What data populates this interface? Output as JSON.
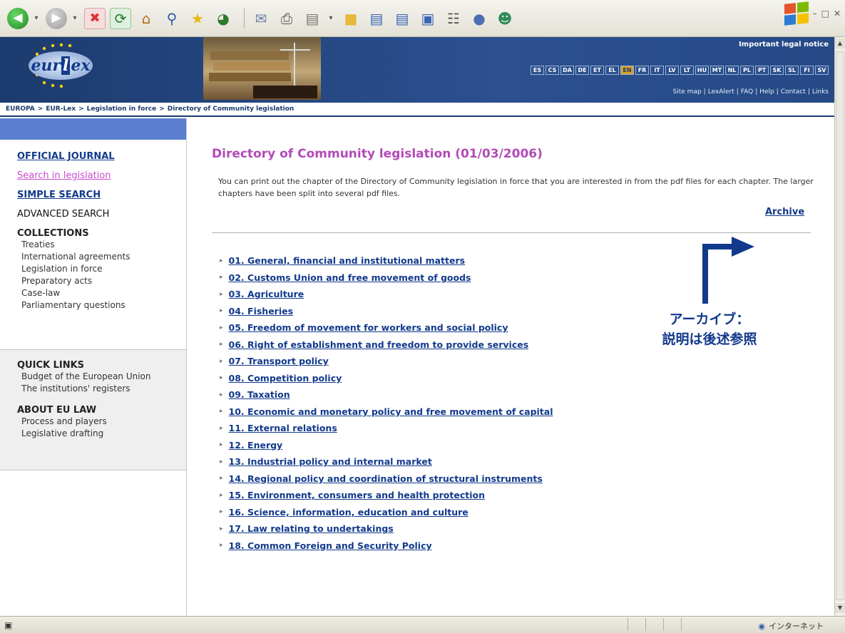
{
  "banner": {
    "legal_notice": "Important legal notice",
    "languages": [
      "ES",
      "CS",
      "DA",
      "DE",
      "ET",
      "EL",
      "EN",
      "FR",
      "IT",
      "LV",
      "LT",
      "HU",
      "MT",
      "NL",
      "PL",
      "PT",
      "SK",
      "SL",
      "FI",
      "SV"
    ],
    "active_language": "EN",
    "links": [
      "Site map",
      "LexAlert",
      "FAQ",
      "Help",
      "Contact",
      "Links"
    ]
  },
  "breadcrumb": [
    "EUROPA",
    "EUR-Lex",
    "Legislation in force",
    "Directory of Community legislation"
  ],
  "sidebar": {
    "official_journal": "OFFICIAL JOURNAL",
    "search_in_legislation": "Search in legislation",
    "simple_search": "SIMPLE SEARCH",
    "advanced_search": "ADVANCED SEARCH",
    "collections_title": "COLLECTIONS",
    "collections": [
      "Treaties",
      "International agreements",
      "Legislation in force",
      "Preparatory acts",
      "Case-law",
      "Parliamentary questions"
    ],
    "quick_links_title": "QUICK LINKS",
    "quick_links": [
      "Budget of the European Union",
      "The institutions' registers"
    ],
    "about_title": "ABOUT EU LAW",
    "about": [
      "Process and players",
      "Legislative drafting"
    ]
  },
  "main": {
    "title": "Directory of Community legislation (01/03/2006)",
    "intro": "You can print out the chapter of the Directory of Community legislation in force that you are interested in from the pdf files for each chapter. The larger chapters have been split into several pdf files.",
    "archive": "Archive",
    "chapters": [
      "01. General, financial and institutional matters",
      "02. Customs Union and free movement of goods",
      "03. Agriculture",
      "04. Fisheries",
      "05. Freedom of movement for workers and social policy",
      "06. Right of establishment and freedom to provide services",
      "07. Transport policy",
      "08. Competition policy",
      "09. Taxation",
      "10. Economic and monetary policy and free movement of capital",
      "11. External relations",
      "12. Energy",
      "13. Industrial policy and internal market",
      "14. Regional policy and coordination of structural instruments",
      "15. Environment, consumers and health protection",
      "16. Science, information, education and culture",
      "17. Law relating to undertakings",
      "18. Common Foreign and Security Policy"
    ]
  },
  "annotation": {
    "line1": "アーカイブ：",
    "line2": "説明は後述参照"
  },
  "status": {
    "zone": "インターネット"
  },
  "colors": {
    "accent": "#123a8c",
    "title": "#b24ab8",
    "banner": "#1c3b6e"
  }
}
